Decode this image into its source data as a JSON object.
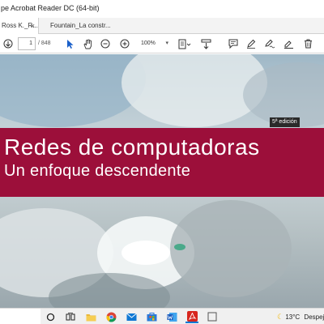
{
  "window": {
    "title": "pe Acrobat Reader DC (64-bit)"
  },
  "tabs": [
    {
      "label": "Ross K._R...",
      "active": true,
      "close": "×"
    },
    {
      "label": "Fountain_La constr...",
      "active": false
    }
  ],
  "toolbar": {
    "page_current": "1",
    "page_total": "/ 848",
    "zoom": "100%",
    "zoom_dropdown": "▾"
  },
  "document": {
    "edition": "5ª edición",
    "title": "Redes de computadoras",
    "subtitle": "Un enfoque descendente",
    "band_color": "#9c0f3a"
  },
  "taskbar": {
    "weather_temp": "13°C",
    "weather_text": "Despeje"
  }
}
